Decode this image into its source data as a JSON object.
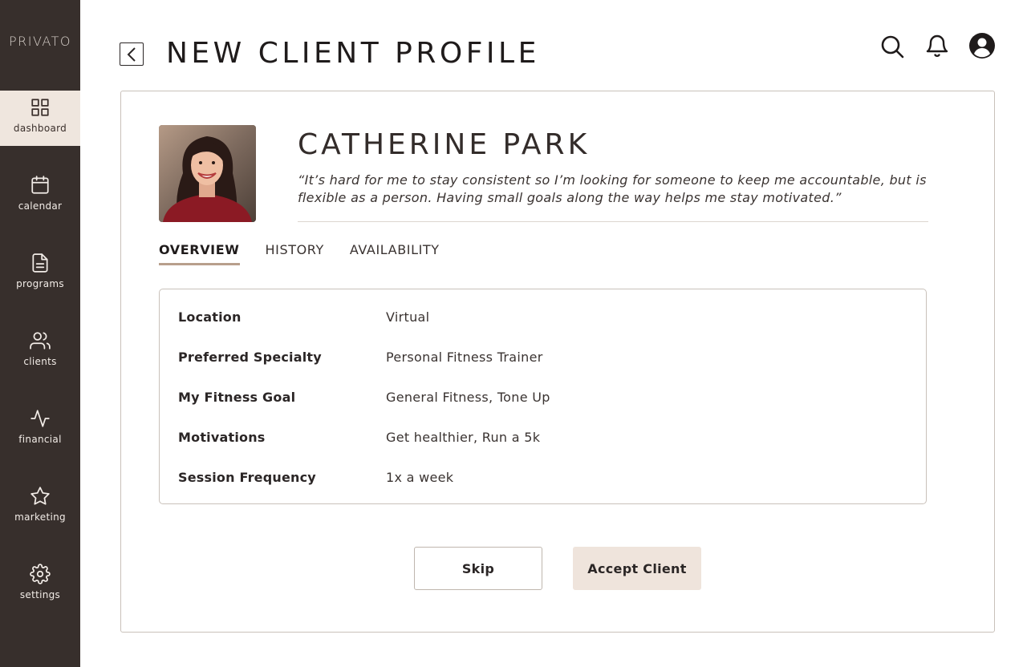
{
  "app": {
    "logo": "PRIVATO"
  },
  "sidebar": {
    "items": [
      {
        "label": "dashboard",
        "icon": "grid-icon",
        "active": true
      },
      {
        "label": "calendar",
        "icon": "calendar-icon",
        "active": false
      },
      {
        "label": "programs",
        "icon": "document-icon",
        "active": false
      },
      {
        "label": "clients",
        "icon": "users-icon",
        "active": false
      },
      {
        "label": "financial",
        "icon": "activity-icon",
        "active": false
      },
      {
        "label": "marketing",
        "icon": "star-icon",
        "active": false
      },
      {
        "label": "settings",
        "icon": "gear-icon",
        "active": false
      }
    ]
  },
  "header": {
    "title": "NEW CLIENT PROFILE",
    "icons": [
      "search-icon",
      "bell-icon",
      "user-circle-icon"
    ]
  },
  "client": {
    "name": "CATHERINE PARK",
    "quote": "“It’s hard for me to stay consistent so I’m looking for someone to keep me accountable, but is flexible as a person. Having small goals along the way helps me stay motivated.”"
  },
  "tabs": [
    {
      "label": "OVERVIEW",
      "active": true
    },
    {
      "label": "HISTORY",
      "active": false
    },
    {
      "label": "AVAILABILITY",
      "active": false
    }
  ],
  "details": [
    {
      "label": "Location",
      "value": "Virtual"
    },
    {
      "label": "Preferred Specialty",
      "value": "Personal Fitness Trainer"
    },
    {
      "label": "My Fitness Goal",
      "value": "General Fitness, Tone Up"
    },
    {
      "label": "Motivations",
      "value": "Get healthier, Run a 5k"
    },
    {
      "label": "Session Frequency",
      "value": "1x a week"
    }
  ],
  "actions": {
    "skip": "Skip",
    "accept": "Accept Client"
  },
  "colors": {
    "sidebar": "#372f2c",
    "active_nav": "#efe6de",
    "accent": "#b89f8c",
    "accept_button": "#efe4dc"
  }
}
